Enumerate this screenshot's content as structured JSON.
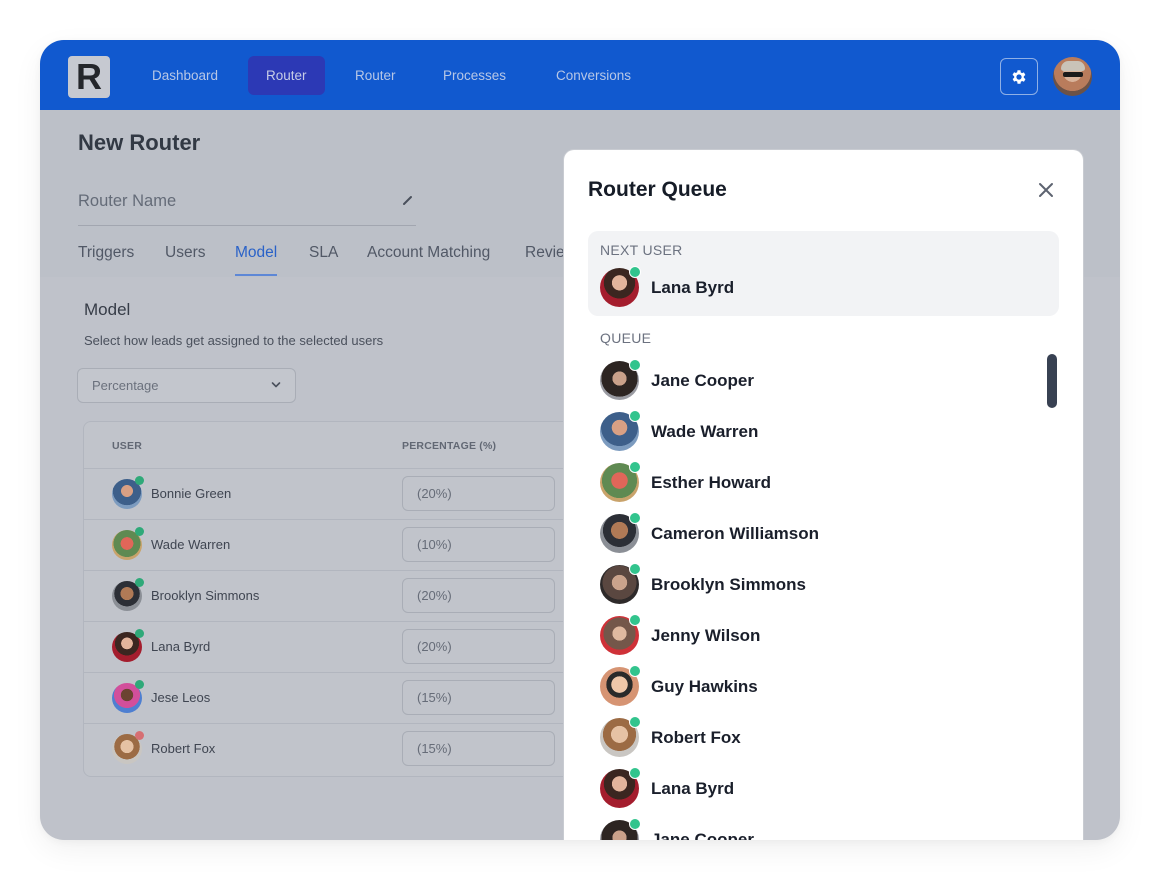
{
  "navbar": {
    "logo_letter": "R",
    "items": [
      {
        "label": "Dashboard",
        "active": false
      },
      {
        "label": "Router",
        "active": true
      },
      {
        "label": "Router",
        "active": false
      },
      {
        "label": "Processes",
        "active": false
      },
      {
        "label": "Conversions",
        "active": false
      }
    ],
    "settings_icon": "gear-icon",
    "brand_color": "#1159cf",
    "active_color": "#2c39b5"
  },
  "page": {
    "title": "New Router",
    "name_placeholder": "Router Name",
    "tabs": [
      {
        "label": "Triggers",
        "active": false
      },
      {
        "label": "Users",
        "active": false
      },
      {
        "label": "Model",
        "active": true
      },
      {
        "label": "SLA",
        "active": false
      },
      {
        "label": "Account Matching",
        "active": false
      },
      {
        "label": "Revie",
        "active": false
      }
    ]
  },
  "model": {
    "title": "Model",
    "description": "Select how leads get assigned to the selected users",
    "selected": "Percentage",
    "table": {
      "columns": [
        "USER",
        "PERCENTAGE (%)"
      ],
      "rows": [
        {
          "name": "Bonnie Green",
          "percentage": "(20%)",
          "online": true
        },
        {
          "name": "Wade Warren",
          "percentage": "(10%)",
          "online": true
        },
        {
          "name": "Brooklyn Simmons",
          "percentage": "(20%)",
          "online": true
        },
        {
          "name": "Lana Byrd",
          "percentage": "(20%)",
          "online": true
        },
        {
          "name": "Jese Leos",
          "percentage": "(15%)",
          "online": true
        },
        {
          "name": "Robert Fox",
          "percentage": "(15%)",
          "online": false
        }
      ]
    }
  },
  "queue_modal": {
    "title": "Router Queue",
    "next_label": "NEXT USER",
    "next_user": {
      "name": "Lana Byrd",
      "online": true
    },
    "queue_label": "QUEUE",
    "queue": [
      {
        "name": "Jane Cooper",
        "online": true
      },
      {
        "name": "Wade Warren",
        "online": true
      },
      {
        "name": "Esther Howard",
        "online": true
      },
      {
        "name": "Cameron Williamson",
        "online": true
      },
      {
        "name": "Brooklyn Simmons",
        "online": true
      },
      {
        "name": "Jenny Wilson",
        "online": true
      },
      {
        "name": "Guy Hawkins",
        "online": true
      },
      {
        "name": "Robert Fox",
        "online": true
      },
      {
        "name": "Lana Byrd",
        "online": true
      },
      {
        "name": "Jane Cooper",
        "online": true
      }
    ],
    "online_color": "#32c48d"
  }
}
